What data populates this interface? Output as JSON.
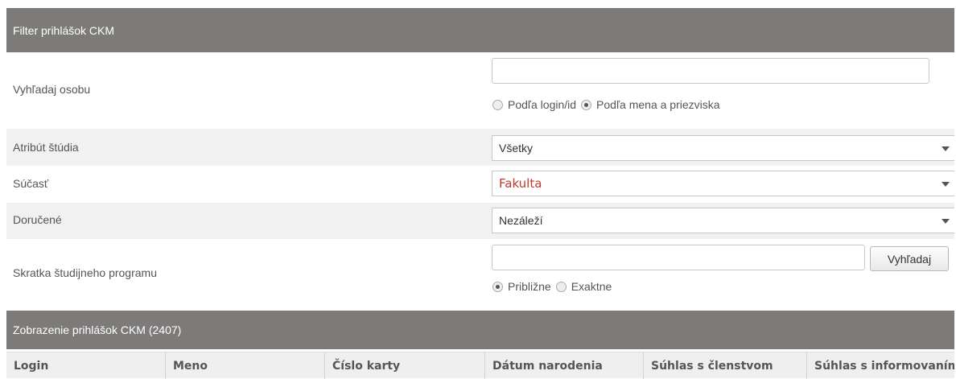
{
  "filter": {
    "title": "Filter prihlášok CKM",
    "search_label": "Vyhľadaj osobu",
    "search_value": "",
    "search_mode_options": [
      "Podľa login/id",
      "Podľa mena a priezviska"
    ],
    "search_mode_selected": "Podľa mena a priezviska",
    "attribute_label": "Atribút štúdia",
    "attribute_value": "Všetky",
    "component_label": "Súčasť",
    "component_value": "Fakulta",
    "delivered_label": "Doručené",
    "delivered_value": "Nezáleží",
    "program_label": "Skratka študijneho programu",
    "program_value": "",
    "search_button": "Vyhľadaj",
    "match_options": [
      "Približne",
      "Exaktne"
    ],
    "match_selected": "Približne"
  },
  "results": {
    "title": "Zobrazenie prihlášok CKM (2407)",
    "columns": [
      "Login",
      "Meno",
      "Číslo karty",
      "Dátum narodenia",
      "Súhlas s členstvom",
      "Súhlas s informovaním"
    ]
  },
  "colors": {
    "header_bg": "#7d7b79",
    "alt_row_bg": "#f1f1f1",
    "accent_text": "#c0392b"
  }
}
